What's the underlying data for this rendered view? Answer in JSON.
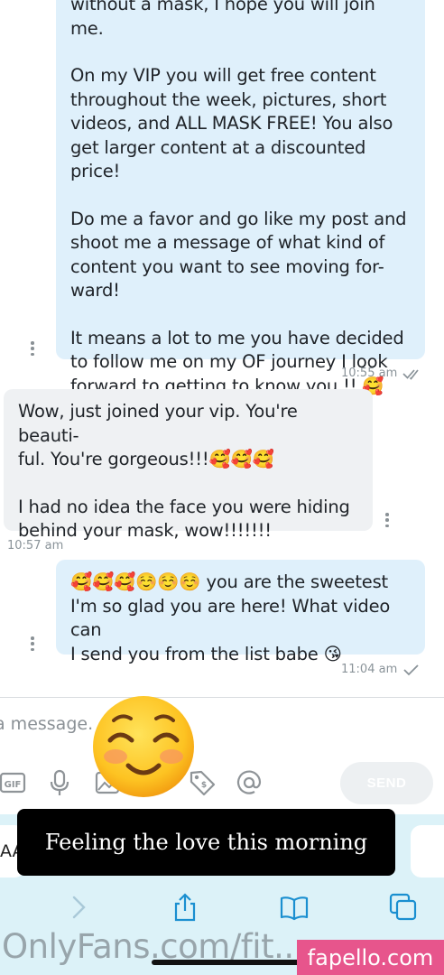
{
  "messages": {
    "first_out": {
      "top_fragment": "without a mask, I hope you will join me.",
      "paragraphs": [
        "On my VIP you will get free content\nthroughout the week, pictures, short\nvideos, and ALL MASK FREE! You also\nget larger content at a discounted price!",
        "Do me a favor and go like my post and\nshoot me a message of what kind of\ncontent you want to see moving for-\nward!",
        "It means a lot to me you have decided\nto follow me on my OF journey I look\nforward to getting to know you !! 🥰"
      ],
      "time": "10:55 am",
      "status_icon": "double-check-icon"
    },
    "incoming": {
      "paragraphs": [
        "Wow, just joined your vip. You're beauti-\nful. You're gorgeous!!!🥰🥰🥰",
        "I had no idea the face you were hiding\nbehind your mask, wow!!!!!!!"
      ],
      "time": "10:57 am"
    },
    "second_out": {
      "paragraphs": [
        "🥰🥰🥰☺️☺️☺️ you are the sweetest\nI'm so glad you are here! What video can\nI send you from the list babe 😘"
      ],
      "time": "11:04 am",
      "status_icon": "check-icon"
    }
  },
  "composer": {
    "placeholder": "a message.",
    "send_label": "SEND",
    "tools": [
      "gif-icon",
      "microphone-icon",
      "image-icon",
      "price-tag-icon",
      "at-sign-icon"
    ]
  },
  "story_overlay": {
    "emoji": "smiling-face-icon",
    "caption": "Feeling the love this morning"
  },
  "browser": {
    "left_pill_text": "AA",
    "nav_icons": [
      "forward-icon",
      "share-icon",
      "bookmarks-icon",
      "tabs-icon"
    ]
  },
  "watermarks": {
    "left": "OnlyFans.com/fit...",
    "right": "fapello.com"
  },
  "colors": {
    "outgoing_bubble": "#dff0fb",
    "incoming_bubble": "#eff1f3",
    "browser_bar": "#dcf2f8",
    "icon_blue": "#1a8fd0",
    "watermark_pink": "#e7558c"
  }
}
